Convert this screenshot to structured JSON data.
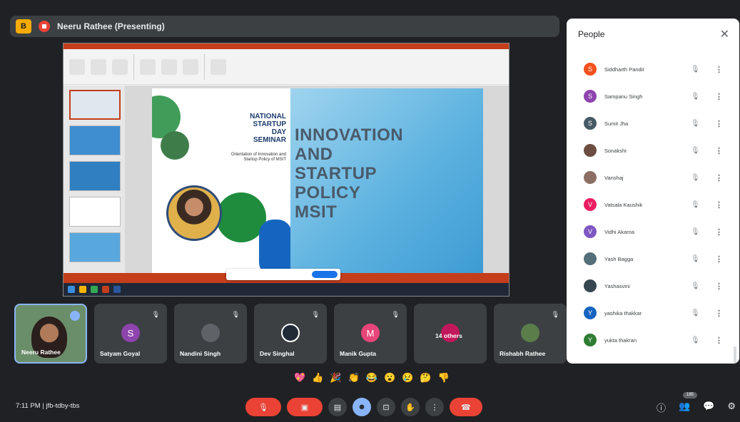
{
  "top_bar": {
    "badge": "B",
    "presenter_label": "Neeru Rathee (Presenting)"
  },
  "slide": {
    "seminar_lines": [
      "NATIONAL",
      "STARTUP",
      "DAY",
      "SEMINAR"
    ],
    "seminar_sub": "Orientation of Innovation and Startup Policy of MSIT",
    "main_lines": [
      "INNOVATION",
      "AND",
      "STARTUP",
      "POLICY",
      "MSIT"
    ]
  },
  "tiles": [
    {
      "name": "Neeru Rathee",
      "initial": "",
      "color": "#6b8e6a"
    },
    {
      "name": "Satyam Goyal",
      "initial": "S",
      "color": "#8e44ad"
    },
    {
      "name": "Nandini Singh",
      "initial": "",
      "color": "#5f6368"
    },
    {
      "name": "Dev Singhal",
      "initial": "",
      "color": "#1f2a36"
    },
    {
      "name": "Manik Gupta",
      "initial": "M",
      "color": "#e8457a"
    },
    {
      "name": "14 others",
      "initial": "",
      "color": "#c2185b"
    },
    {
      "name": "Rishabh Rathee",
      "initial": "",
      "color": "#5a7d4a"
    }
  ],
  "people_panel": {
    "title": "People",
    "close_icon": "close-icon",
    "people": [
      {
        "name": "Siddharth Pandit",
        "initial": "S",
        "color": "#f4511e"
      },
      {
        "name": "Sampanu Singh",
        "initial": "S",
        "color": "#8e44ad"
      },
      {
        "name": "Sumit Jha",
        "initial": "S",
        "color": "#455a64"
      },
      {
        "name": "Sonakshi",
        "initial": "",
        "color": "#6d4c41"
      },
      {
        "name": "Vanshaj",
        "initial": "",
        "color": "#8d6e63"
      },
      {
        "name": "Vatsala Kaushik",
        "initial": "V",
        "color": "#e91e63"
      },
      {
        "name": "Vidhi Akarna",
        "initial": "V",
        "color": "#7e57c2"
      },
      {
        "name": "Yash Bagga",
        "initial": "",
        "color": "#546e7a"
      },
      {
        "name": "Yashasvini",
        "initial": "",
        "color": "#37474f"
      },
      {
        "name": "yashika thakkar",
        "initial": "Y",
        "color": "#1565c0"
      },
      {
        "name": "yukta thakran",
        "initial": "Y",
        "color": "#2e7d32"
      }
    ]
  },
  "reactions": [
    "💖",
    "👍",
    "🎉",
    "👏",
    "😂",
    "😮",
    "😢",
    "🤔",
    "👎"
  ],
  "bottom": {
    "time": "7:11 PM",
    "separator": "|",
    "meeting_code": "jfb-tdby-tbs",
    "people_count": "185"
  }
}
